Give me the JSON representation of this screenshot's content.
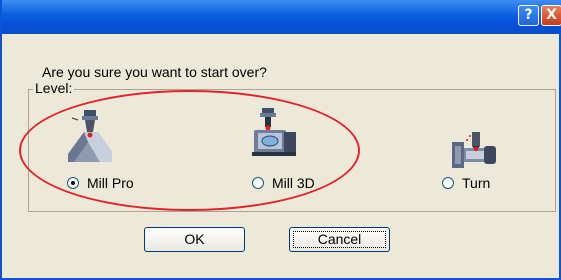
{
  "titlebar": {
    "help_label": "?",
    "close_label": "X"
  },
  "dialog": {
    "prompt": "Are you sure you want to start over?",
    "group_label": "Level:",
    "options": [
      {
        "label": "Mill Pro",
        "selected": true,
        "icon": "mill-pro-icon"
      },
      {
        "label": "Mill 3D",
        "selected": false,
        "icon": "mill-3d-icon"
      },
      {
        "label": "Turn",
        "selected": false,
        "icon": "turn-icon"
      }
    ],
    "ok_label": "OK",
    "cancel_label": "Cancel"
  },
  "colors": {
    "titlebar": "#0a5fe0",
    "dialog_bg": "#ece9d8",
    "annotation": "#e8202a"
  }
}
